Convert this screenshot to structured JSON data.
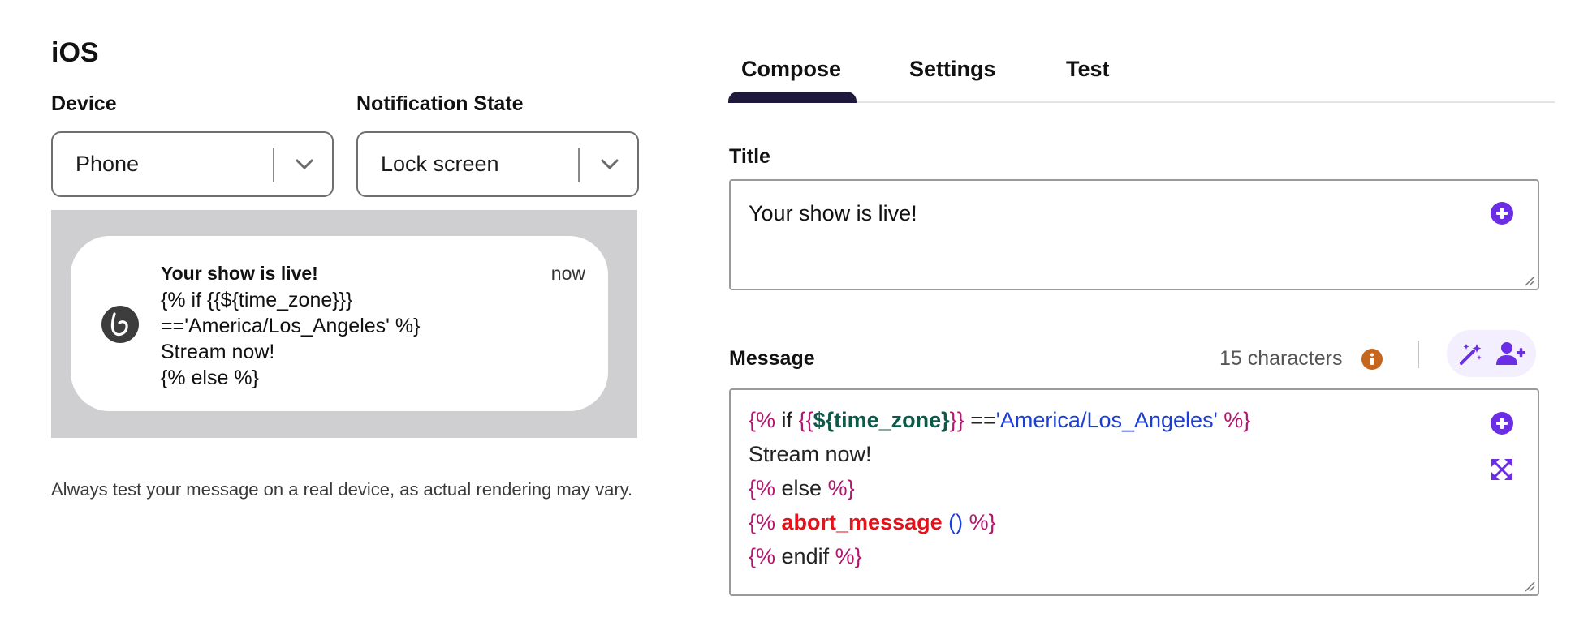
{
  "preview": {
    "platform": "iOS",
    "device": {
      "label": "Device",
      "value": "Phone"
    },
    "state": {
      "label": "Notification State",
      "value": "Lock screen"
    },
    "notification": {
      "title": "Your show is live!",
      "time": "now",
      "body_lines": [
        "{% if {{${time_zone}}}",
        "=='America/Los_Angeles' %}",
        "Stream now!",
        "{% else %}"
      ]
    },
    "disclaimer": "Always test your message on a real device, as actual rendering may vary."
  },
  "tabs": [
    "Compose",
    "Settings",
    "Test"
  ],
  "active_tab": "Compose",
  "colors": {
    "accent": "#6b2ee6",
    "tab_indicator": "#1f1a3d",
    "info_badge": "#c5661f",
    "liquid_tag": "#b4166e",
    "attribute": "#0b5a4a",
    "string": "#1a3ed6",
    "abort": "#e3121b"
  },
  "compose": {
    "title": {
      "label": "Title",
      "value": "Your show is live!",
      "add_icon": "plus-circle-icon"
    },
    "message": {
      "label": "Message",
      "char_count": "15 characters",
      "info_icon": "info-icon",
      "ai_icon": "magic-wand-icon",
      "personalize_icon": "add-person-icon",
      "add_icon": "plus-circle-icon",
      "expand_icon": "expand-icon",
      "code_lines": [
        [
          [
            "liquid",
            "{%"
          ],
          [
            "plain",
            " if "
          ],
          [
            "liquid",
            "{{"
          ],
          [
            "attr",
            "${time_zone}"
          ],
          [
            "liquid",
            "}}"
          ],
          [
            "plain",
            " =="
          ],
          [
            "string",
            "'America/Los_Angeles'"
          ],
          [
            "liquid",
            " %}"
          ]
        ],
        [
          [
            "plain",
            "Stream now!"
          ]
        ],
        [
          [
            "liquid",
            "{%"
          ],
          [
            "plain",
            " else "
          ],
          [
            "liquid",
            "%}"
          ]
        ],
        [
          [
            "liquid",
            "{% "
          ],
          [
            "abort",
            "abort_message"
          ],
          [
            "paren",
            " ()"
          ],
          [
            "liquid",
            " %}"
          ]
        ],
        [
          [
            "liquid",
            "{%"
          ],
          [
            "plain",
            " endif "
          ],
          [
            "liquid",
            "%}"
          ]
        ]
      ]
    }
  }
}
